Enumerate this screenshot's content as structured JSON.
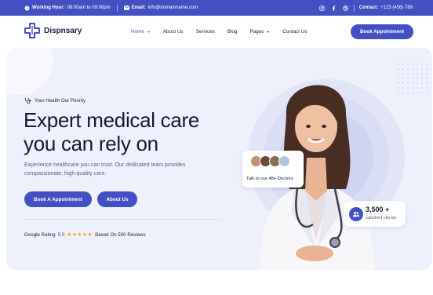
{
  "topbar": {
    "hours_label": "Working Hour:",
    "hours_value": "08:00am to 09:00pm",
    "email_label": "Email:",
    "email_value": "info@domainname.com",
    "contact_label": "Contact:",
    "contact_value": "+123 (456) 789",
    "social_icons": [
      "instagram-icon",
      "facebook-icon",
      "dribbble-icon"
    ]
  },
  "header": {
    "logo_text": "Dispnsary",
    "nav": [
      {
        "label": "Home",
        "active": true,
        "dropdown": true
      },
      {
        "label": "About Us",
        "active": false,
        "dropdown": false
      },
      {
        "label": "Services",
        "active": false,
        "dropdown": false
      },
      {
        "label": "Blog",
        "active": false,
        "dropdown": false
      },
      {
        "label": "Pages",
        "active": false,
        "dropdown": true
      },
      {
        "label": "Contact Us",
        "active": false,
        "dropdown": false
      }
    ],
    "cta_label": "Book Appointment"
  },
  "hero": {
    "tagline": "Your Health Our Priority",
    "headline_line1": "Expert medical care",
    "headline_line2": "you can rely on",
    "subtext_line1": "Experience healthcare you can trust. Our dedicated team provides",
    "subtext_line2": "compassionate, high-quality care.",
    "primary_button": "Book A Appointment",
    "secondary_button": "About Us",
    "rating_label": "Google Rating",
    "rating_score": "5.0",
    "stars": "★★★★★",
    "rating_reviews": "Based On 500 Reviews"
  },
  "cards": {
    "doctors_label": "Talk to our 48+ Doctors",
    "clients_count": "3,500 +",
    "clients_label": "satisfied clients"
  },
  "colors": {
    "brand": "#4350c3",
    "hero_bg": "#eef0fb",
    "star": "#f6a623"
  }
}
